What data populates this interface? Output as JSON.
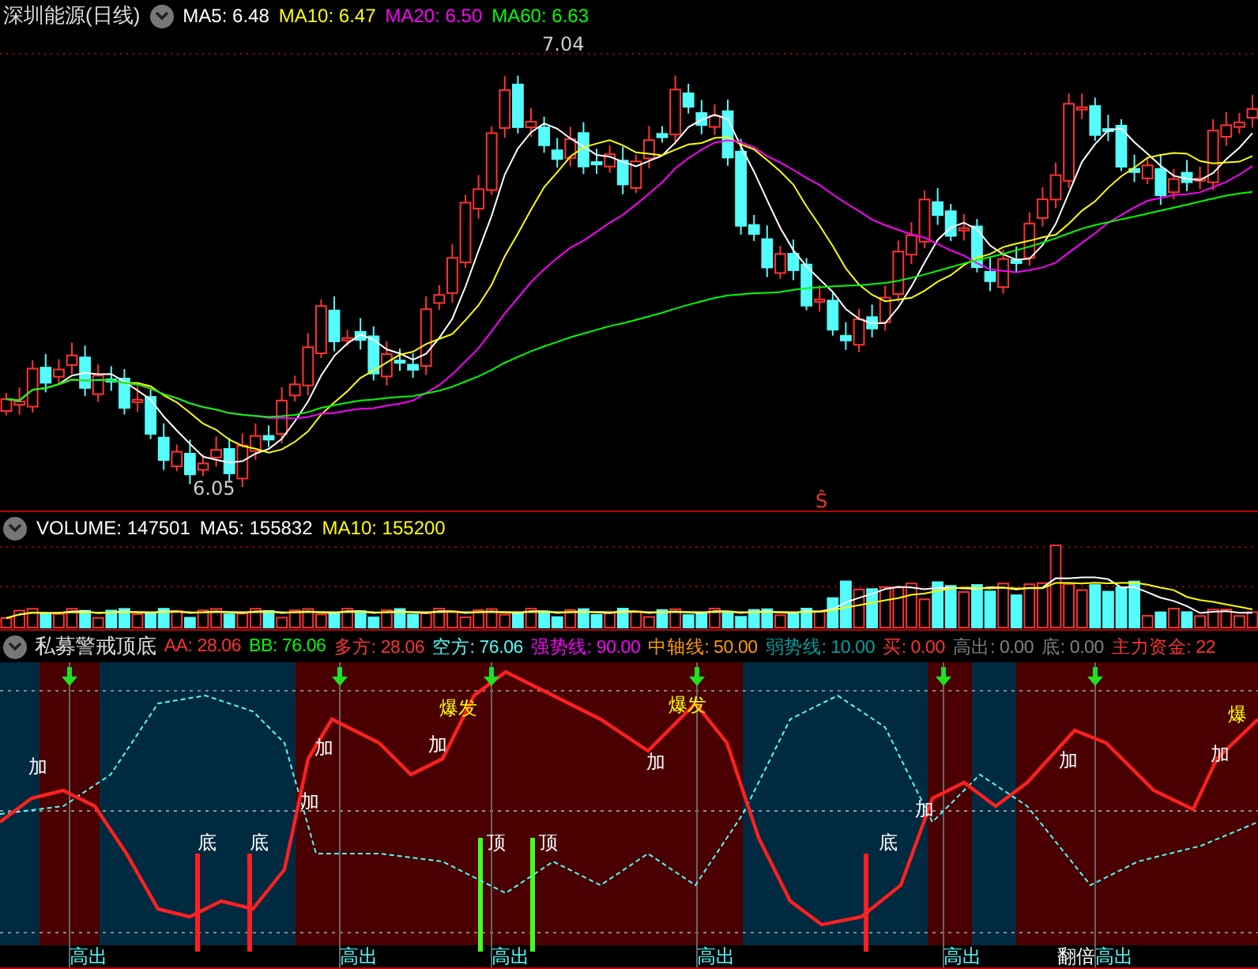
{
  "price_panel": {
    "title": "深圳能源(日线)",
    "legend": [
      {
        "label": "MA5:",
        "value": "6.48",
        "color": "#ffffff"
      },
      {
        "label": "MA10:",
        "value": "6.47",
        "color": "#ffff00"
      },
      {
        "label": "MA20:",
        "value": "6.50",
        "color": "#ff00ff"
      },
      {
        "label": "MA60:",
        "value": "6.63",
        "color": "#00ff00"
      }
    ],
    "high_label": "7.04",
    "low_label": "6.05",
    "signal_mark": "Ŝ"
  },
  "volume_panel": {
    "legend": [
      {
        "label": "VOLUME:",
        "value": "147501",
        "color": "#ffffff"
      },
      {
        "label": "MA5:",
        "value": "155832",
        "color": "#ffffff"
      },
      {
        "label": "MA10:",
        "value": "155200",
        "color": "#ffff00"
      }
    ]
  },
  "indicator_panel": {
    "title": "私募警戒顶底",
    "legend": [
      {
        "label": "AA:",
        "value": "28.06",
        "color": "#ff3232"
      },
      {
        "label": "BB:",
        "value": "76.06",
        "color": "#00ff00"
      },
      {
        "label": "多方:",
        "value": "28.06",
        "color": "#ff3232"
      },
      {
        "label": "空方:",
        "value": "76.06",
        "color": "#54fcfc"
      },
      {
        "label": "强势线:",
        "value": "90.00",
        "color": "#ff00ff"
      },
      {
        "label": "中轴线:",
        "value": "50.00",
        "color": "#ff9900"
      },
      {
        "label": "弱势线:",
        "value": "10.00",
        "color": "#00a0a0"
      },
      {
        "label": "买:",
        "value": "0.00",
        "color": "#ff3232"
      },
      {
        "label": "高出:",
        "value": "0.00",
        "color": "#808080"
      },
      {
        "label": "底:",
        "value": "0.00",
        "color": "#808080"
      },
      {
        "label": "主力资金:",
        "value": "22",
        "color": "#ff3232"
      }
    ],
    "markers": [
      {
        "kind": "add",
        "text": "加"
      },
      {
        "kind": "add",
        "text": "加"
      },
      {
        "kind": "add",
        "text": "加"
      },
      {
        "kind": "burst",
        "text": "爆发"
      },
      {
        "kind": "add",
        "text": "加"
      },
      {
        "kind": "burst",
        "text": "爆发"
      },
      {
        "kind": "add",
        "text": "加"
      },
      {
        "kind": "bottom",
        "text": "底"
      },
      {
        "kind": "bottom",
        "text": "底"
      },
      {
        "kind": "top",
        "text": "顶"
      },
      {
        "kind": "top",
        "text": "顶"
      },
      {
        "kind": "bottom",
        "text": "底"
      },
      {
        "kind": "add",
        "text": "加"
      },
      {
        "kind": "add",
        "text": "加"
      },
      {
        "kind": "add",
        "text": "加"
      },
      {
        "kind": "burst",
        "text": "爆"
      }
    ],
    "bottom_labels": [
      {
        "kind": "high",
        "text": "高出"
      },
      {
        "kind": "high",
        "text": "高出"
      },
      {
        "kind": "high",
        "text": "高出"
      },
      {
        "kind": "high",
        "text": "高出"
      },
      {
        "kind": "high",
        "text": "高出"
      },
      {
        "kind": "double",
        "text": "翻倍"
      },
      {
        "kind": "high",
        "text": "高出"
      }
    ]
  }
}
